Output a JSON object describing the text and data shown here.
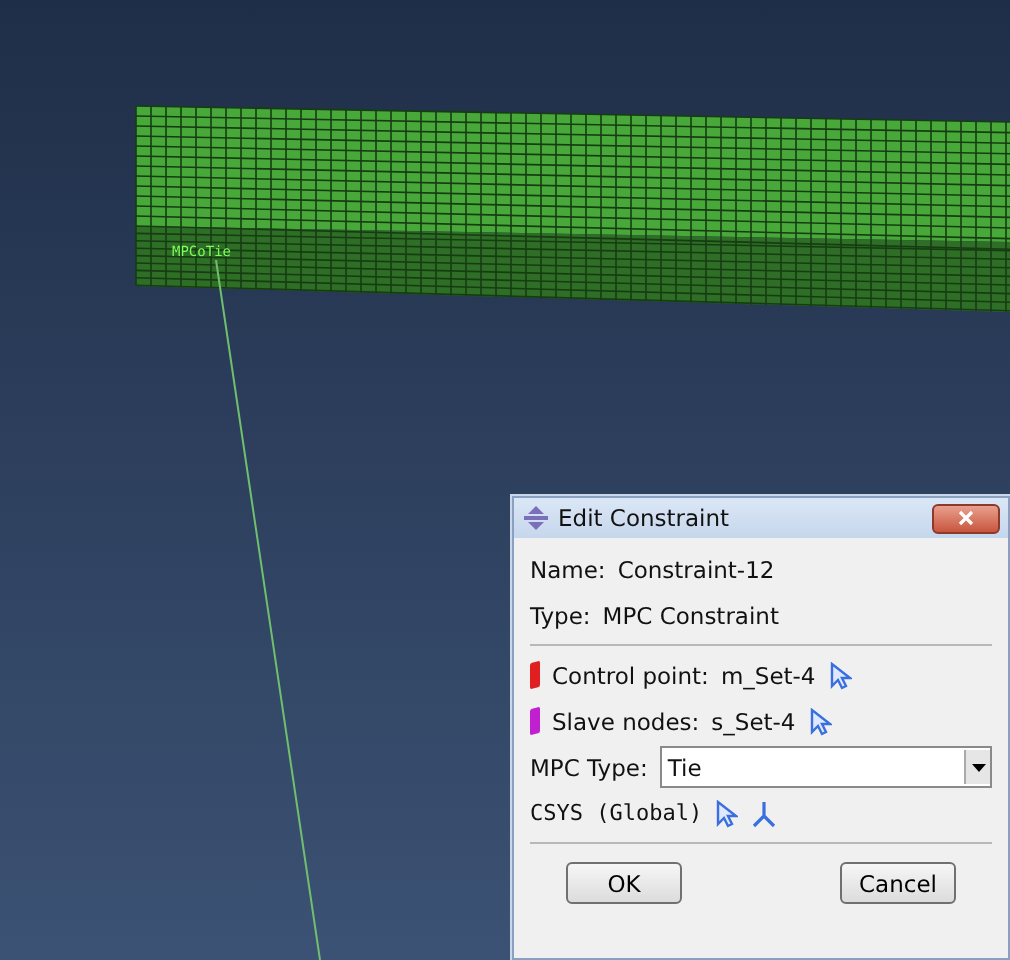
{
  "viewport": {
    "mesh_label": "MPCoTie"
  },
  "dialog": {
    "title": "Edit Constraint",
    "fields": [
      {
        "label": "Name:",
        "value": "Constraint-12"
      },
      {
        "label": "Type:",
        "value": "MPC Constraint"
      }
    ],
    "regions": [
      {
        "label": "Control point:",
        "value": "m_Set-4",
        "color": "#e02020"
      },
      {
        "label": "Slave nodes:",
        "value": "s_Set-4",
        "color": "#c020d0"
      }
    ],
    "mpc_type": {
      "label": "MPC Type:",
      "value": "Tie"
    },
    "csys": {
      "label": "CSYS (Global)"
    },
    "buttons": [
      "OK",
      "Cancel"
    ]
  }
}
